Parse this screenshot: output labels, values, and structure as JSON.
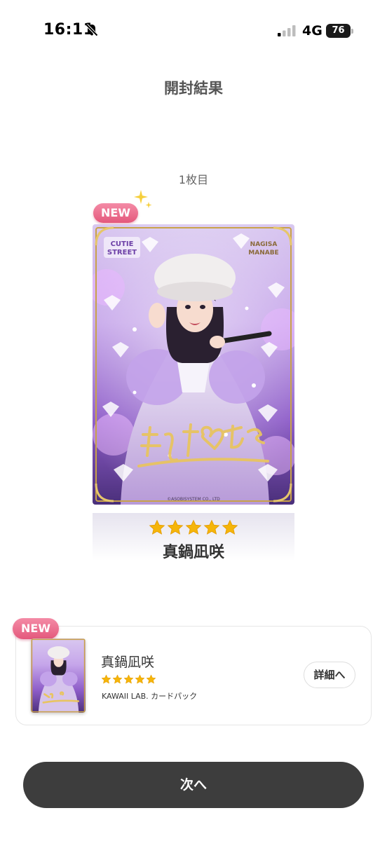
{
  "status_bar": {
    "time": "16:11",
    "network": "4G",
    "battery": "76"
  },
  "page": {
    "title": "開封結果",
    "card_index": "1枚目"
  },
  "card": {
    "badge": "NEW",
    "brand_logo": "CUTIE STREET",
    "brand_logo_line1": "CUTIE",
    "brand_logo_line2": "STREET",
    "member_romaji_line1": "NAGISA",
    "member_romaji_line2": "MANABE",
    "copyright": "©ASOBISYSTEM CO., LTD",
    "rarity": 5,
    "member_name": "真鍋凪咲"
  },
  "summary": {
    "badge": "NEW",
    "member_name": "真鍋凪咲",
    "rarity": 5,
    "pack_name": "KAWAII LAB. カードパック",
    "detail_label": "詳細へ"
  },
  "footer": {
    "next_label": "次へ"
  },
  "colors": {
    "accent_pink": "#e4587c",
    "star_gold": "#f5b50a",
    "button_dark": "#3d3d3d",
    "frame_gold": "#c9a24a",
    "card_lilac": "#b98ee0"
  },
  "icons": {
    "bell": "bell-slash-icon",
    "signal": "signal-bars-icon",
    "battery": "battery-icon",
    "sparkle": "sparkle-icon",
    "star": "star-icon"
  }
}
